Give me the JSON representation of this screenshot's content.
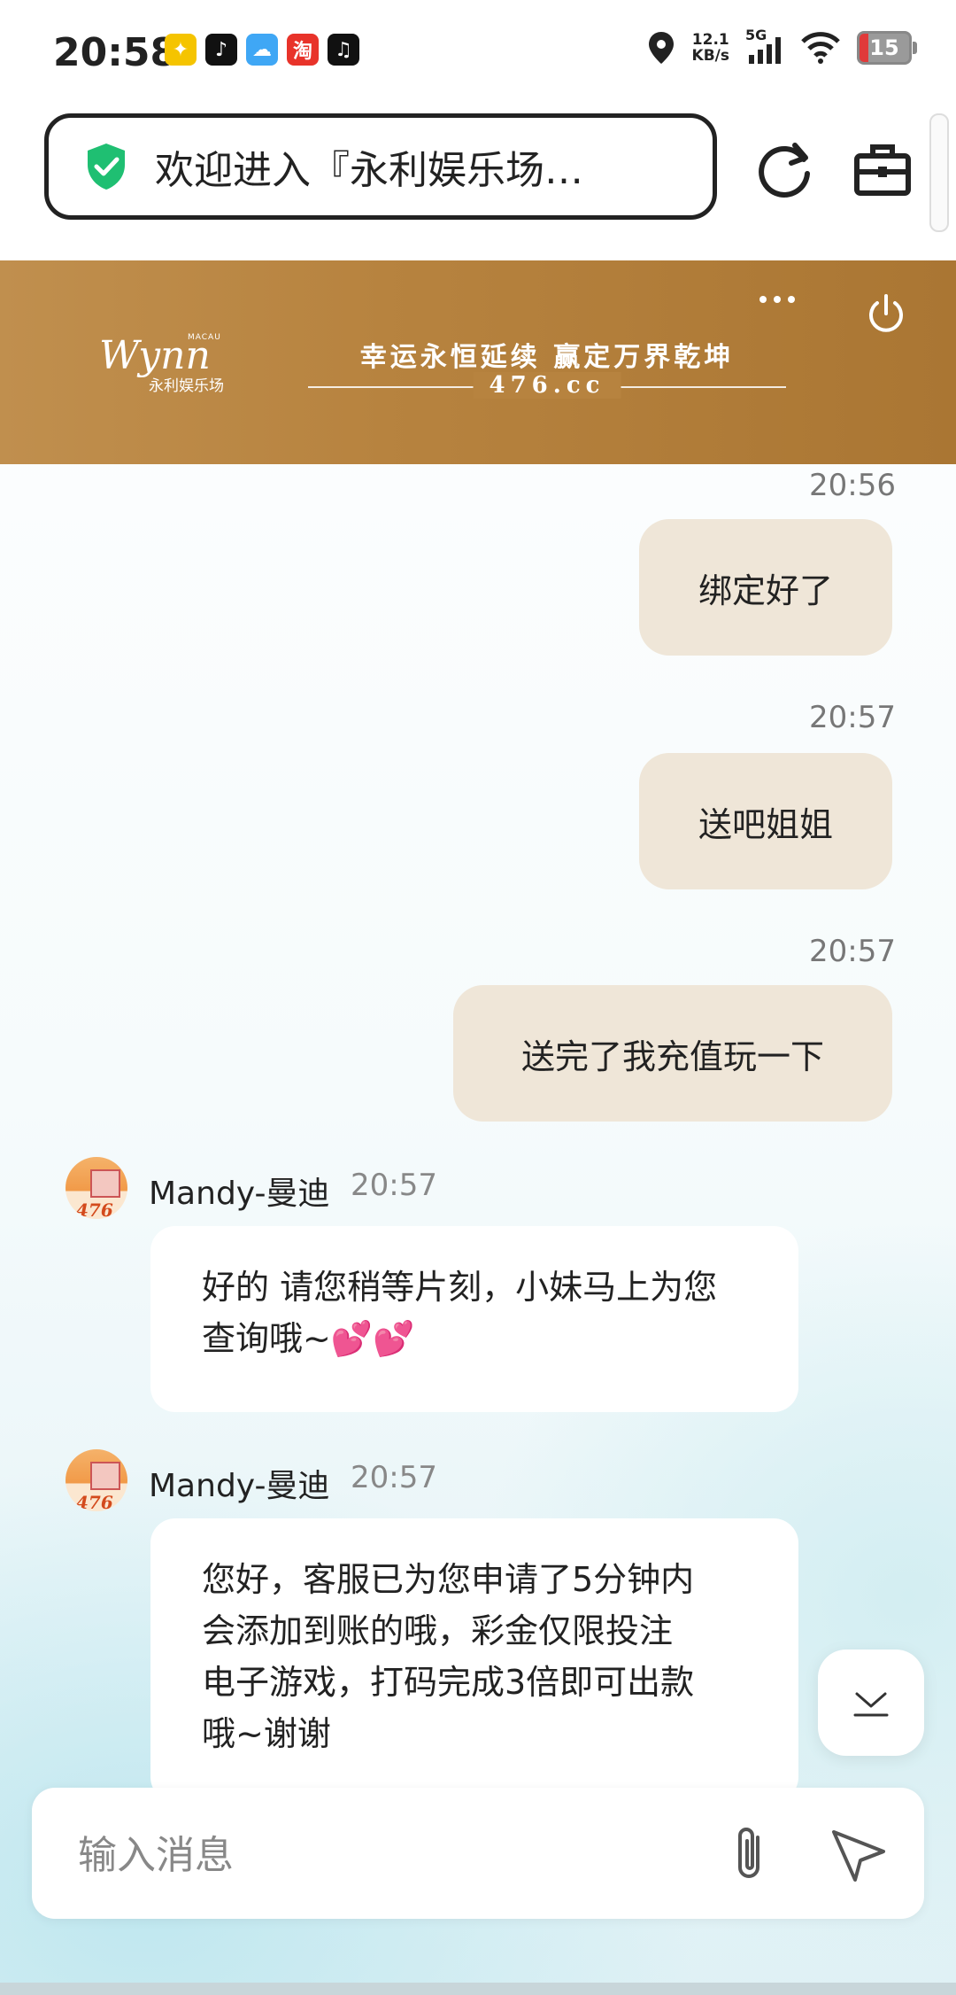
{
  "status_bar": {
    "time": "20:58",
    "net_speed_value": "12.1",
    "net_speed_unit": "KB/s",
    "network": "5G",
    "battery": "15",
    "app_icons": [
      "game-app-icon",
      "music-app-icon",
      "weather-app-icon",
      "taobao-app-icon",
      "tiktok-app-icon"
    ]
  },
  "browser": {
    "url_text": "欢迎进入『永利娱乐场…",
    "icons": {
      "security": "shield-check-icon",
      "refresh": "refresh-icon",
      "toolbox": "briefcase-icon"
    }
  },
  "banner": {
    "logo_script": "Wynn",
    "logo_macau": "MACAU",
    "logo_cn": "永利娱乐场",
    "slogan": "幸运永恒延续 赢定万界乾坤",
    "domain": "476.cc",
    "colors": {
      "background": "#b7833f"
    }
  },
  "messages": {
    "outgoing": [
      {
        "time": "20:56",
        "text": "绑定好了"
      },
      {
        "time": "20:57",
        "text": "送吧姐姐"
      },
      {
        "time": "20:57",
        "text": "送完了我充值玩一下"
      }
    ],
    "incoming": [
      {
        "sender": "Mandy-曼迪",
        "time": "20:57",
        "text": "好的 请您稍等片刻，小妹马上为您查询哦~",
        "emoji": "💕💕",
        "avatar_label": "476"
      },
      {
        "sender": "Mandy-曼迪",
        "time": "20:57",
        "line1": "您好，客服已为您申请了5分钟内",
        "line2": "会添加到账的哦，彩金仅限投注",
        "line3": "电子游戏，打码完成3倍即可出款",
        "line4": "哦~谢谢",
        "avatar_label": "476"
      }
    ]
  },
  "composer": {
    "placeholder": "输入消息",
    "icons": {
      "attach": "paperclip-icon",
      "send": "send-icon",
      "scroll_down": "chevron-down-icon"
    }
  }
}
